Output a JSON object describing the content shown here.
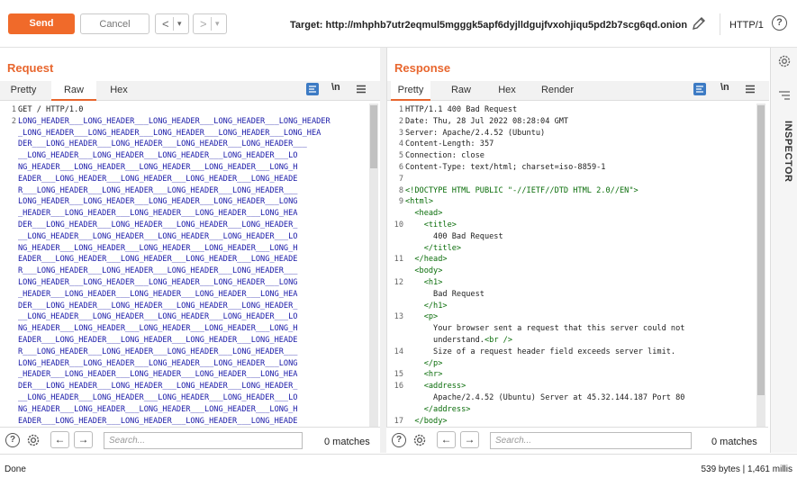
{
  "toolbar": {
    "send_label": "Send",
    "cancel_label": "Cancel",
    "back_glyph": "<",
    "forward_glyph": ">",
    "dropdown_glyph": "▾",
    "target_label": "Target: http://mhphb7utr2eqmul5mgggk5apf6dyjlldgujfvxohjiqu5pd2b7scg6qd.onion",
    "http_version": "HTTP/1",
    "help_glyph": "?"
  },
  "request": {
    "title": "Request",
    "tabs": [
      "Pretty",
      "Raw",
      "Hex"
    ],
    "active_tab": "Raw",
    "newline_toggle": "\\n",
    "line_numbers": [
      "1",
      "2"
    ],
    "lines": [
      "GET / HTTP/1.0",
      "LONG_HEADER___LONG_HEADER___LONG_HEADER___LONG_HEADER___LONG_HEADER",
      "_LONG_HEADER___LONG_HEADER___LONG_HEADER___LONG_HEADER___LONG_HEA",
      "DER___LONG_HEADER___LONG_HEADER___LONG_HEADER___LONG_HEADER___",
      "__LONG_HEADER___LONG_HEADER___LONG_HEADER___LONG_HEADER___LO",
      "NG_HEADER___LONG_HEADER___LONG_HEADER___LONG_HEADER___LONG_H",
      "EADER___LONG_HEADER___LONG_HEADER___LONG_HEADER___LONG_HEADE",
      "R___LONG_HEADER___LONG_HEADER___LONG_HEADER___LONG_HEADER___",
      "LONG_HEADER___LONG_HEADER___LONG_HEADER___LONG_HEADER___LONG",
      "_HEADER___LONG_HEADER___LONG_HEADER___LONG_HEADER___LONG_HEA",
      "DER___LONG_HEADER___LONG_HEADER___LONG_HEADER___LONG_HEADER_",
      "__LONG_HEADER___LONG_HEADER___LONG_HEADER___LONG_HEADER___LO",
      "NG_HEADER___LONG_HEADER___LONG_HEADER___LONG_HEADER___LONG_H",
      "EADER___LONG_HEADER___LONG_HEADER___LONG_HEADER___LONG_HEADE",
      "R___LONG_HEADER___LONG_HEADER___LONG_HEADER___LONG_HEADER___",
      "LONG_HEADER___LONG_HEADER___LONG_HEADER___LONG_HEADER___LONG",
      "_HEADER___LONG_HEADER___LONG_HEADER___LONG_HEADER___LONG_HEA",
      "DER___LONG_HEADER___LONG_HEADER___LONG_HEADER___LONG_HEADER_",
      "__LONG_HEADER___LONG_HEADER___LONG_HEADER___LONG_HEADER___LO",
      "NG_HEADER___LONG_HEADER___LONG_HEADER___LONG_HEADER___LONG_H",
      "EADER___LONG_HEADER___LONG_HEADER___LONG_HEADER___LONG_HEADE",
      "R___LONG_HEADER___LONG_HEADER___LONG_HEADER___LONG_HEADER___",
      "LONG_HEADER___LONG_HEADER___LONG_HEADER___LONG_HEADER___LONG",
      "_HEADER___LONG_HEADER___LONG_HEADER___LONG_HEADER___LONG_HEA",
      "DER___LONG_HEADER___LONG_HEADER___LONG_HEADER___LONG_HEADER_",
      "__LONG_HEADER___LONG_HEADER___LONG_HEADER___LONG_HEADER___LO",
      "NG_HEADER___LONG_HEADER___LONG_HEADER___LONG_HEADER___LONG_H",
      "EADER___LONG_HEADER___LONG_HEADER___LONG_HEADER___LONG_HEADE"
    ],
    "search_placeholder": "Search...",
    "matches": "0 matches"
  },
  "response": {
    "title": "Response",
    "tabs": [
      "Pretty",
      "Raw",
      "Hex",
      "Render"
    ],
    "active_tab": "Pretty",
    "newline_toggle": "\\n",
    "rows": [
      {
        "n": "1",
        "t": "HTTP/1.1 400 Bad Request",
        "c": "plain"
      },
      {
        "n": "2",
        "t": "Date: Thu, 28 Jul 2022 08:28:04 GMT",
        "c": "plain"
      },
      {
        "n": "3",
        "t": "Server: Apache/2.4.52 (Ubuntu)",
        "c": "plain"
      },
      {
        "n": "4",
        "t": "Content-Length: 357",
        "c": "plain"
      },
      {
        "n": "5",
        "t": "Connection: close",
        "c": "plain"
      },
      {
        "n": "6",
        "t": "Content-Type: text/html; charset=iso-8859-1",
        "c": "plain"
      },
      {
        "n": "7",
        "t": "",
        "c": "plain"
      },
      {
        "n": "8",
        "t": "<!DOCTYPE HTML PUBLIC \"-//IETF//DTD HTML 2.0//EN\">",
        "c": "tag"
      },
      {
        "n": "9",
        "t": "<html>",
        "c": "tag"
      },
      {
        "n": "",
        "t": "  <head>",
        "c": "tag"
      },
      {
        "n": "10",
        "t": "    <title>",
        "c": "tag"
      },
      {
        "n": "",
        "t": "      400 Bad Request",
        "c": "plain"
      },
      {
        "n": "",
        "t": "    </title>",
        "c": "tag"
      },
      {
        "n": "11",
        "t": "  </head>",
        "c": "tag"
      },
      {
        "n": "",
        "t": "  <body>",
        "c": "tag"
      },
      {
        "n": "12",
        "t": "    <h1>",
        "c": "tag"
      },
      {
        "n": "",
        "t": "      Bad Request",
        "c": "plain"
      },
      {
        "n": "",
        "t": "    </h1>",
        "c": "tag"
      },
      {
        "n": "13",
        "t": "    <p>",
        "c": "tag"
      },
      {
        "n": "",
        "t": "      Your browser sent a request that this server could not",
        "c": "plain"
      },
      {
        "n": "",
        "t": "      understand.<br />",
        "c": "mixed"
      },
      {
        "n": "14",
        "t": "      Size of a request header field exceeds server limit.",
        "c": "plain"
      },
      {
        "n": "",
        "t": "    </p>",
        "c": "tag"
      },
      {
        "n": "15",
        "t": "    <hr>",
        "c": "tag"
      },
      {
        "n": "16",
        "t": "    <address>",
        "c": "tag"
      },
      {
        "n": "",
        "t": "      Apache/2.4.52 (Ubuntu) Server at 45.32.144.187 Port 80",
        "c": "plain"
      },
      {
        "n": "",
        "t": "    </address>",
        "c": "tag"
      },
      {
        "n": "17",
        "t": "  </body>",
        "c": "tag"
      }
    ],
    "search_placeholder": "Search...",
    "matches": "0 matches"
  },
  "sidebar": {
    "inspector_label": "INSPECTOR"
  },
  "status": {
    "left": "Done",
    "right": "539 bytes | 1,461 millis"
  },
  "colors": {
    "accent": "#e8662e",
    "send": "#f06a2a",
    "layout_active": "#4a86c8"
  }
}
